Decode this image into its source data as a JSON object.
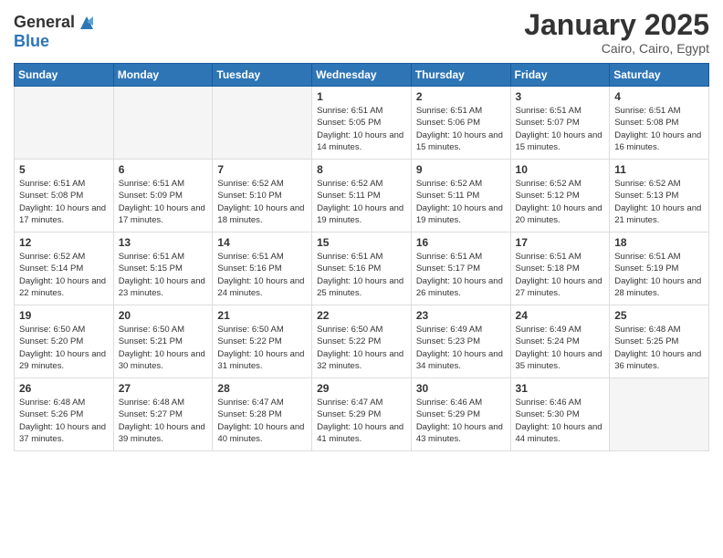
{
  "logo": {
    "general": "General",
    "blue": "Blue"
  },
  "header": {
    "month": "January 2025",
    "location": "Cairo, Cairo, Egypt"
  },
  "days": [
    "Sunday",
    "Monday",
    "Tuesday",
    "Wednesday",
    "Thursday",
    "Friday",
    "Saturday"
  ],
  "weeks": [
    [
      {
        "num": "",
        "sunrise": "",
        "sunset": "",
        "daylight": "",
        "empty": true
      },
      {
        "num": "",
        "sunrise": "",
        "sunset": "",
        "daylight": "",
        "empty": true
      },
      {
        "num": "",
        "sunrise": "",
        "sunset": "",
        "daylight": "",
        "empty": true
      },
      {
        "num": "1",
        "sunrise": "Sunrise: 6:51 AM",
        "sunset": "Sunset: 5:05 PM",
        "daylight": "Daylight: 10 hours and 14 minutes.",
        "empty": false
      },
      {
        "num": "2",
        "sunrise": "Sunrise: 6:51 AM",
        "sunset": "Sunset: 5:06 PM",
        "daylight": "Daylight: 10 hours and 15 minutes.",
        "empty": false
      },
      {
        "num": "3",
        "sunrise": "Sunrise: 6:51 AM",
        "sunset": "Sunset: 5:07 PM",
        "daylight": "Daylight: 10 hours and 15 minutes.",
        "empty": false
      },
      {
        "num": "4",
        "sunrise": "Sunrise: 6:51 AM",
        "sunset": "Sunset: 5:08 PM",
        "daylight": "Daylight: 10 hours and 16 minutes.",
        "empty": false
      }
    ],
    [
      {
        "num": "5",
        "sunrise": "Sunrise: 6:51 AM",
        "sunset": "Sunset: 5:08 PM",
        "daylight": "Daylight: 10 hours and 17 minutes.",
        "empty": false
      },
      {
        "num": "6",
        "sunrise": "Sunrise: 6:51 AM",
        "sunset": "Sunset: 5:09 PM",
        "daylight": "Daylight: 10 hours and 17 minutes.",
        "empty": false
      },
      {
        "num": "7",
        "sunrise": "Sunrise: 6:52 AM",
        "sunset": "Sunset: 5:10 PM",
        "daylight": "Daylight: 10 hours and 18 minutes.",
        "empty": false
      },
      {
        "num": "8",
        "sunrise": "Sunrise: 6:52 AM",
        "sunset": "Sunset: 5:11 PM",
        "daylight": "Daylight: 10 hours and 19 minutes.",
        "empty": false
      },
      {
        "num": "9",
        "sunrise": "Sunrise: 6:52 AM",
        "sunset": "Sunset: 5:11 PM",
        "daylight": "Daylight: 10 hours and 19 minutes.",
        "empty": false
      },
      {
        "num": "10",
        "sunrise": "Sunrise: 6:52 AM",
        "sunset": "Sunset: 5:12 PM",
        "daylight": "Daylight: 10 hours and 20 minutes.",
        "empty": false
      },
      {
        "num": "11",
        "sunrise": "Sunrise: 6:52 AM",
        "sunset": "Sunset: 5:13 PM",
        "daylight": "Daylight: 10 hours and 21 minutes.",
        "empty": false
      }
    ],
    [
      {
        "num": "12",
        "sunrise": "Sunrise: 6:52 AM",
        "sunset": "Sunset: 5:14 PM",
        "daylight": "Daylight: 10 hours and 22 minutes.",
        "empty": false
      },
      {
        "num": "13",
        "sunrise": "Sunrise: 6:51 AM",
        "sunset": "Sunset: 5:15 PM",
        "daylight": "Daylight: 10 hours and 23 minutes.",
        "empty": false
      },
      {
        "num": "14",
        "sunrise": "Sunrise: 6:51 AM",
        "sunset": "Sunset: 5:16 PM",
        "daylight": "Daylight: 10 hours and 24 minutes.",
        "empty": false
      },
      {
        "num": "15",
        "sunrise": "Sunrise: 6:51 AM",
        "sunset": "Sunset: 5:16 PM",
        "daylight": "Daylight: 10 hours and 25 minutes.",
        "empty": false
      },
      {
        "num": "16",
        "sunrise": "Sunrise: 6:51 AM",
        "sunset": "Sunset: 5:17 PM",
        "daylight": "Daylight: 10 hours and 26 minutes.",
        "empty": false
      },
      {
        "num": "17",
        "sunrise": "Sunrise: 6:51 AM",
        "sunset": "Sunset: 5:18 PM",
        "daylight": "Daylight: 10 hours and 27 minutes.",
        "empty": false
      },
      {
        "num": "18",
        "sunrise": "Sunrise: 6:51 AM",
        "sunset": "Sunset: 5:19 PM",
        "daylight": "Daylight: 10 hours and 28 minutes.",
        "empty": false
      }
    ],
    [
      {
        "num": "19",
        "sunrise": "Sunrise: 6:50 AM",
        "sunset": "Sunset: 5:20 PM",
        "daylight": "Daylight: 10 hours and 29 minutes.",
        "empty": false
      },
      {
        "num": "20",
        "sunrise": "Sunrise: 6:50 AM",
        "sunset": "Sunset: 5:21 PM",
        "daylight": "Daylight: 10 hours and 30 minutes.",
        "empty": false
      },
      {
        "num": "21",
        "sunrise": "Sunrise: 6:50 AM",
        "sunset": "Sunset: 5:22 PM",
        "daylight": "Daylight: 10 hours and 31 minutes.",
        "empty": false
      },
      {
        "num": "22",
        "sunrise": "Sunrise: 6:50 AM",
        "sunset": "Sunset: 5:22 PM",
        "daylight": "Daylight: 10 hours and 32 minutes.",
        "empty": false
      },
      {
        "num": "23",
        "sunrise": "Sunrise: 6:49 AM",
        "sunset": "Sunset: 5:23 PM",
        "daylight": "Daylight: 10 hours and 34 minutes.",
        "empty": false
      },
      {
        "num": "24",
        "sunrise": "Sunrise: 6:49 AM",
        "sunset": "Sunset: 5:24 PM",
        "daylight": "Daylight: 10 hours and 35 minutes.",
        "empty": false
      },
      {
        "num": "25",
        "sunrise": "Sunrise: 6:48 AM",
        "sunset": "Sunset: 5:25 PM",
        "daylight": "Daylight: 10 hours and 36 minutes.",
        "empty": false
      }
    ],
    [
      {
        "num": "26",
        "sunrise": "Sunrise: 6:48 AM",
        "sunset": "Sunset: 5:26 PM",
        "daylight": "Daylight: 10 hours and 37 minutes.",
        "empty": false
      },
      {
        "num": "27",
        "sunrise": "Sunrise: 6:48 AM",
        "sunset": "Sunset: 5:27 PM",
        "daylight": "Daylight: 10 hours and 39 minutes.",
        "empty": false
      },
      {
        "num": "28",
        "sunrise": "Sunrise: 6:47 AM",
        "sunset": "Sunset: 5:28 PM",
        "daylight": "Daylight: 10 hours and 40 minutes.",
        "empty": false
      },
      {
        "num": "29",
        "sunrise": "Sunrise: 6:47 AM",
        "sunset": "Sunset: 5:29 PM",
        "daylight": "Daylight: 10 hours and 41 minutes.",
        "empty": false
      },
      {
        "num": "30",
        "sunrise": "Sunrise: 6:46 AM",
        "sunset": "Sunset: 5:29 PM",
        "daylight": "Daylight: 10 hours and 43 minutes.",
        "empty": false
      },
      {
        "num": "31",
        "sunrise": "Sunrise: 6:46 AM",
        "sunset": "Sunset: 5:30 PM",
        "daylight": "Daylight: 10 hours and 44 minutes.",
        "empty": false
      },
      {
        "num": "",
        "sunrise": "",
        "sunset": "",
        "daylight": "",
        "empty": true
      }
    ]
  ]
}
